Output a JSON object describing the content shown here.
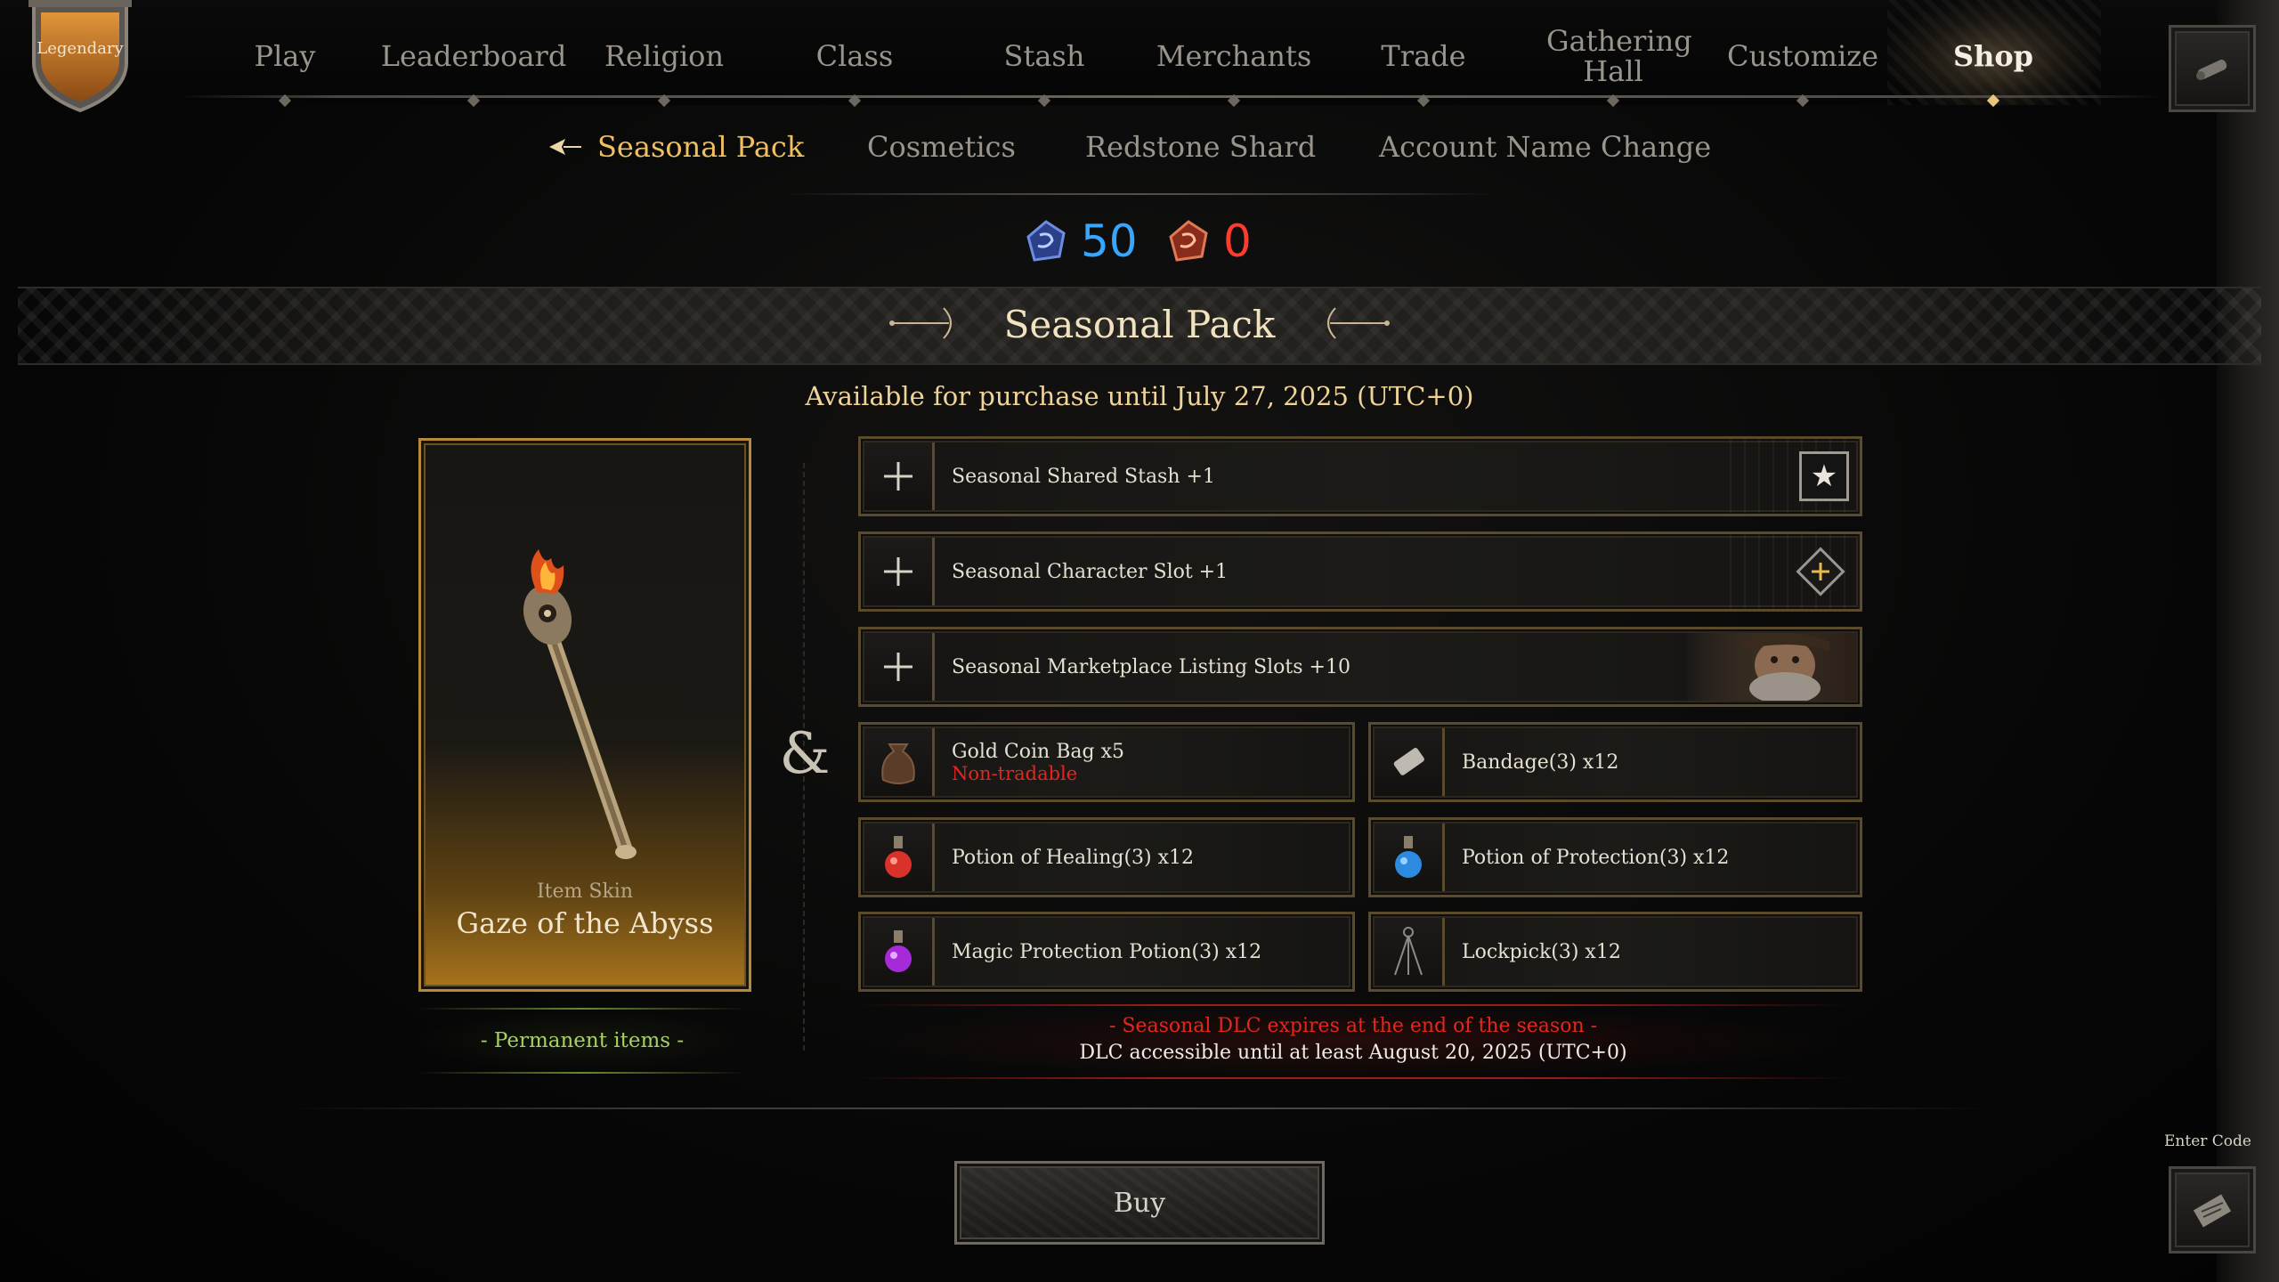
{
  "badge": {
    "label": "Legendary"
  },
  "nav": {
    "items": [
      {
        "label": "Play",
        "active": false
      },
      {
        "label": "Leaderboard",
        "active": false
      },
      {
        "label": "Religion",
        "active": false
      },
      {
        "label": "Class",
        "active": false
      },
      {
        "label": "Stash",
        "active": false
      },
      {
        "label": "Merchants",
        "active": false
      },
      {
        "label": "Trade",
        "active": false
      },
      {
        "label": "Gathering Hall",
        "active": false
      },
      {
        "label": "Customize",
        "active": false
      },
      {
        "label": "Shop",
        "active": true
      }
    ]
  },
  "subtabs": [
    {
      "label": "Seasonal Pack",
      "active": true
    },
    {
      "label": "Cosmetics",
      "active": false
    },
    {
      "label": "Redstone Shard",
      "active": false
    },
    {
      "label": "Account Name Change",
      "active": false
    }
  ],
  "currency": {
    "blue": {
      "value": "50",
      "color": "#36a6ff"
    },
    "red": {
      "value": "0",
      "color": "#ff3a2e"
    }
  },
  "section": {
    "title": "Seasonal Pack",
    "availability": "Available for purchase until July 27, 2025 (UTC+0)"
  },
  "item": {
    "sub": "Item Skin",
    "name": "Gaze of the Abyss",
    "permanent": "- Permanent items -"
  },
  "ampersand": "&",
  "features": [
    {
      "label": "Seasonal Shared Stash +1",
      "icon": "plus-icon"
    },
    {
      "label": "Seasonal Character Slot +1",
      "icon": "plus-icon"
    },
    {
      "label": "Seasonal Marketplace Listing Slots +10",
      "icon": "plus-icon"
    }
  ],
  "items": [
    {
      "label": "Gold Coin Bag x5",
      "note": "Non-tradable",
      "icon": "coin-bag-icon"
    },
    {
      "label": "Bandage(3) x12",
      "note": "",
      "icon": "bandage-icon"
    },
    {
      "label": "Potion of Healing(3) x12",
      "note": "",
      "icon": "healing-potion-icon"
    },
    {
      "label": "Potion of Protection(3) x12",
      "note": "",
      "icon": "protection-potion-icon"
    },
    {
      "label": "Magic Protection Potion(3) x12",
      "note": "",
      "icon": "magic-potion-icon"
    },
    {
      "label": "Lockpick(3) x12",
      "note": "",
      "icon": "lockpick-icon"
    }
  ],
  "dlc": {
    "warning": "- Seasonal DLC expires at the end of the season -",
    "info": "DLC accessible until at least August 20, 2025 (UTC+0)"
  },
  "buy_label": "Buy",
  "enter_code_label": "Enter Code",
  "colors": {
    "accent_gold": "#f0c060",
    "frame_gold": "#b58a3a",
    "warn_red": "#e4261f",
    "permanent_green": "#a6d160"
  }
}
